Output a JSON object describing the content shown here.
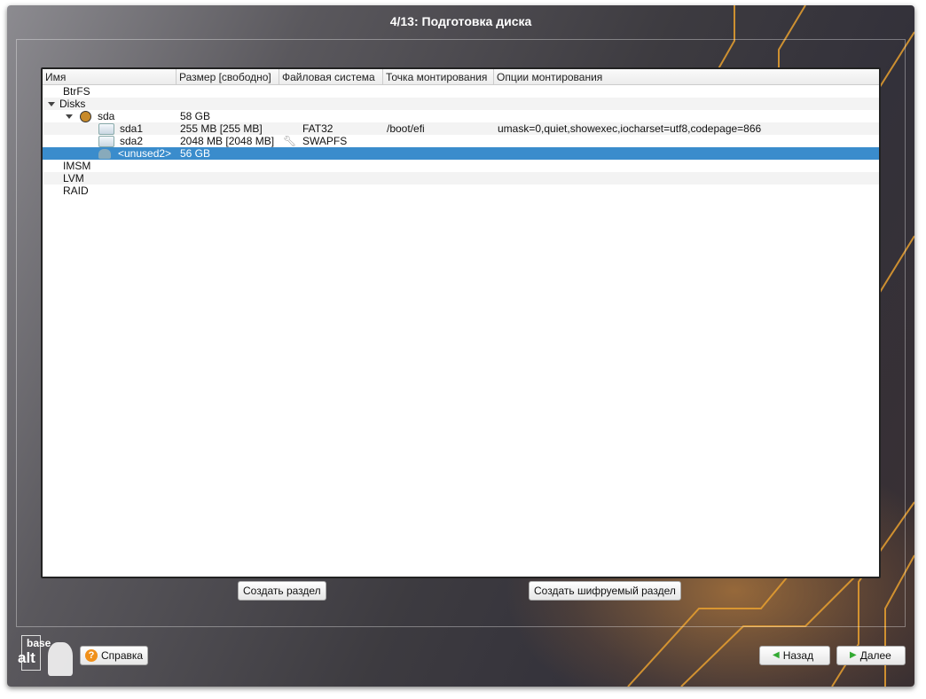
{
  "title": "4/13: Подготовка диска",
  "columns": [
    "Имя",
    "Размер [свободно]",
    "Файловая система",
    "Точка монтирования",
    "Опции монтирования"
  ],
  "rows": [
    {
      "name": "BtrFS",
      "size": "",
      "fs": "",
      "mount": "",
      "opts": ""
    },
    {
      "name": "Disks",
      "size": "",
      "fs": "",
      "mount": "",
      "opts": ""
    },
    {
      "name": "sda",
      "size": "58 GB",
      "fs": "",
      "mount": "",
      "opts": ""
    },
    {
      "name": "sda1",
      "size": "255 MB [255 MB]",
      "fs": "FAT32",
      "mount": "/boot/efi",
      "opts": "umask=0,quiet,showexec,iocharset=utf8,codepage=866"
    },
    {
      "name": "sda2",
      "size": "2048 MB [2048 MB]",
      "fs": "SWAPFS",
      "mount": "",
      "opts": ""
    },
    {
      "name": "<unused2>",
      "size": "56 GB",
      "fs": "",
      "mount": "",
      "opts": ""
    },
    {
      "name": "IMSM",
      "size": "",
      "fs": "",
      "mount": "",
      "opts": ""
    },
    {
      "name": "LVM",
      "size": "",
      "fs": "",
      "mount": "",
      "opts": ""
    },
    {
      "name": "RAID",
      "size": "",
      "fs": "",
      "mount": "",
      "opts": ""
    }
  ],
  "buttons": {
    "create": "Создать раздел",
    "create_enc": "Создать шифруемый раздел",
    "help": "Справка",
    "back": "Назад",
    "next": "Далее"
  },
  "logo": {
    "top": "base",
    "bottom": "alt"
  }
}
